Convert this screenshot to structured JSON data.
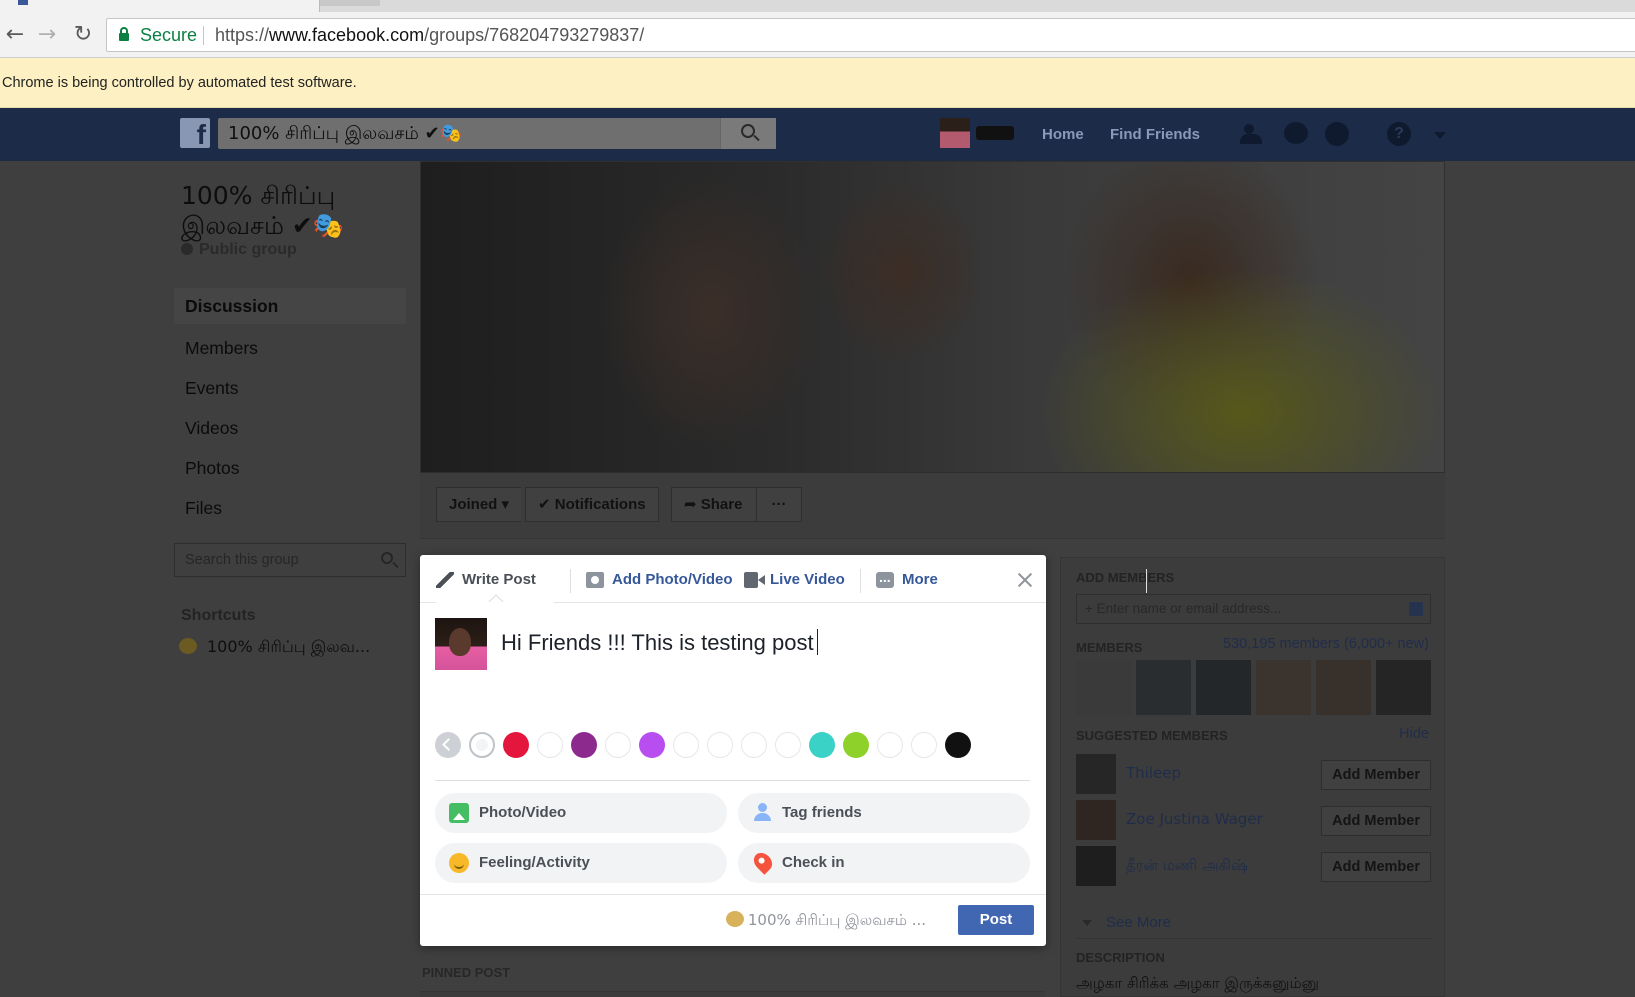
{
  "browser": {
    "secure_label": "Secure",
    "url_prefix": "https://",
    "url_host": "www.facebook.com",
    "url_path": "/groups/768204793279837/",
    "infobar_text": "Chrome is being controlled by automated test software."
  },
  "fb_header": {
    "logo": "f",
    "search_value": "100% சிரிப்பு இலவசம் ✔🎭",
    "nav": {
      "home": "Home",
      "find_friends": "Find Friends"
    },
    "icons": [
      "friends-icon",
      "messenger-icon",
      "globe-icon",
      "help-icon",
      "chevron-down-icon"
    ]
  },
  "group": {
    "title": "100% சிரிப்பு இலவசம் ✔🎭",
    "privacy": "Public group"
  },
  "sidebar": {
    "items": [
      {
        "label": "Discussion",
        "active": true
      },
      {
        "label": "Members"
      },
      {
        "label": "Events"
      },
      {
        "label": "Videos"
      },
      {
        "label": "Photos"
      },
      {
        "label": "Files"
      }
    ],
    "search_placeholder": "Search this group",
    "shortcuts_heading": "Shortcuts",
    "shortcut_item": "100% சிரிப்பு இலவ..."
  },
  "actions": {
    "joined": "Joined",
    "notifications": "Notifications",
    "share": "Share",
    "more": "···"
  },
  "composer": {
    "tabs": {
      "write_post": "Write Post",
      "add_photo": "Add Photo/Video",
      "live_video": "Live Video",
      "more": "More"
    },
    "text": "Hi Friends !!! This is testing post",
    "swatch_colors": [
      "#cdd0d4",
      "#ffffff",
      "#e4163e",
      "#ffffff",
      "#8c2a8e",
      "#ffffff",
      "#b84df0",
      "#ffffff",
      "#ffffff",
      "#ffffff",
      "#ffffff",
      "#3ad2c6",
      "#8ed12a",
      "#ffffff",
      "#ffffff",
      "#111111"
    ],
    "options": {
      "photo_video": "Photo/Video",
      "tag_friends": "Tag friends",
      "feeling": "Feeling/Activity",
      "check_in": "Check in"
    },
    "share_to": "100% சிரிப்பு இலவசம் ...",
    "post_button": "Post"
  },
  "right_column": {
    "add_members_heading": "ADD MEMBERS",
    "add_placeholder": "+ Enter name or email address...",
    "members_heading": "MEMBERS",
    "members_count": "530,195 members (6,000+ new)",
    "suggested_heading": "SUGGESTED MEMBERS",
    "hide": "Hide",
    "suggested": [
      {
        "name": "Thileep",
        "button": "Add Member"
      },
      {
        "name": "Zoe Justina Wager",
        "button": "Add Member"
      },
      {
        "name": "தீரன் மணி அகிஷ்",
        "button": "Add Member"
      }
    ],
    "see_more": "See More",
    "description_heading": "DESCRIPTION",
    "description_text": "அழகா சிரிக்க அழகா இருக்கனும்னு"
  },
  "pinned_heading": "PINNED POST"
}
